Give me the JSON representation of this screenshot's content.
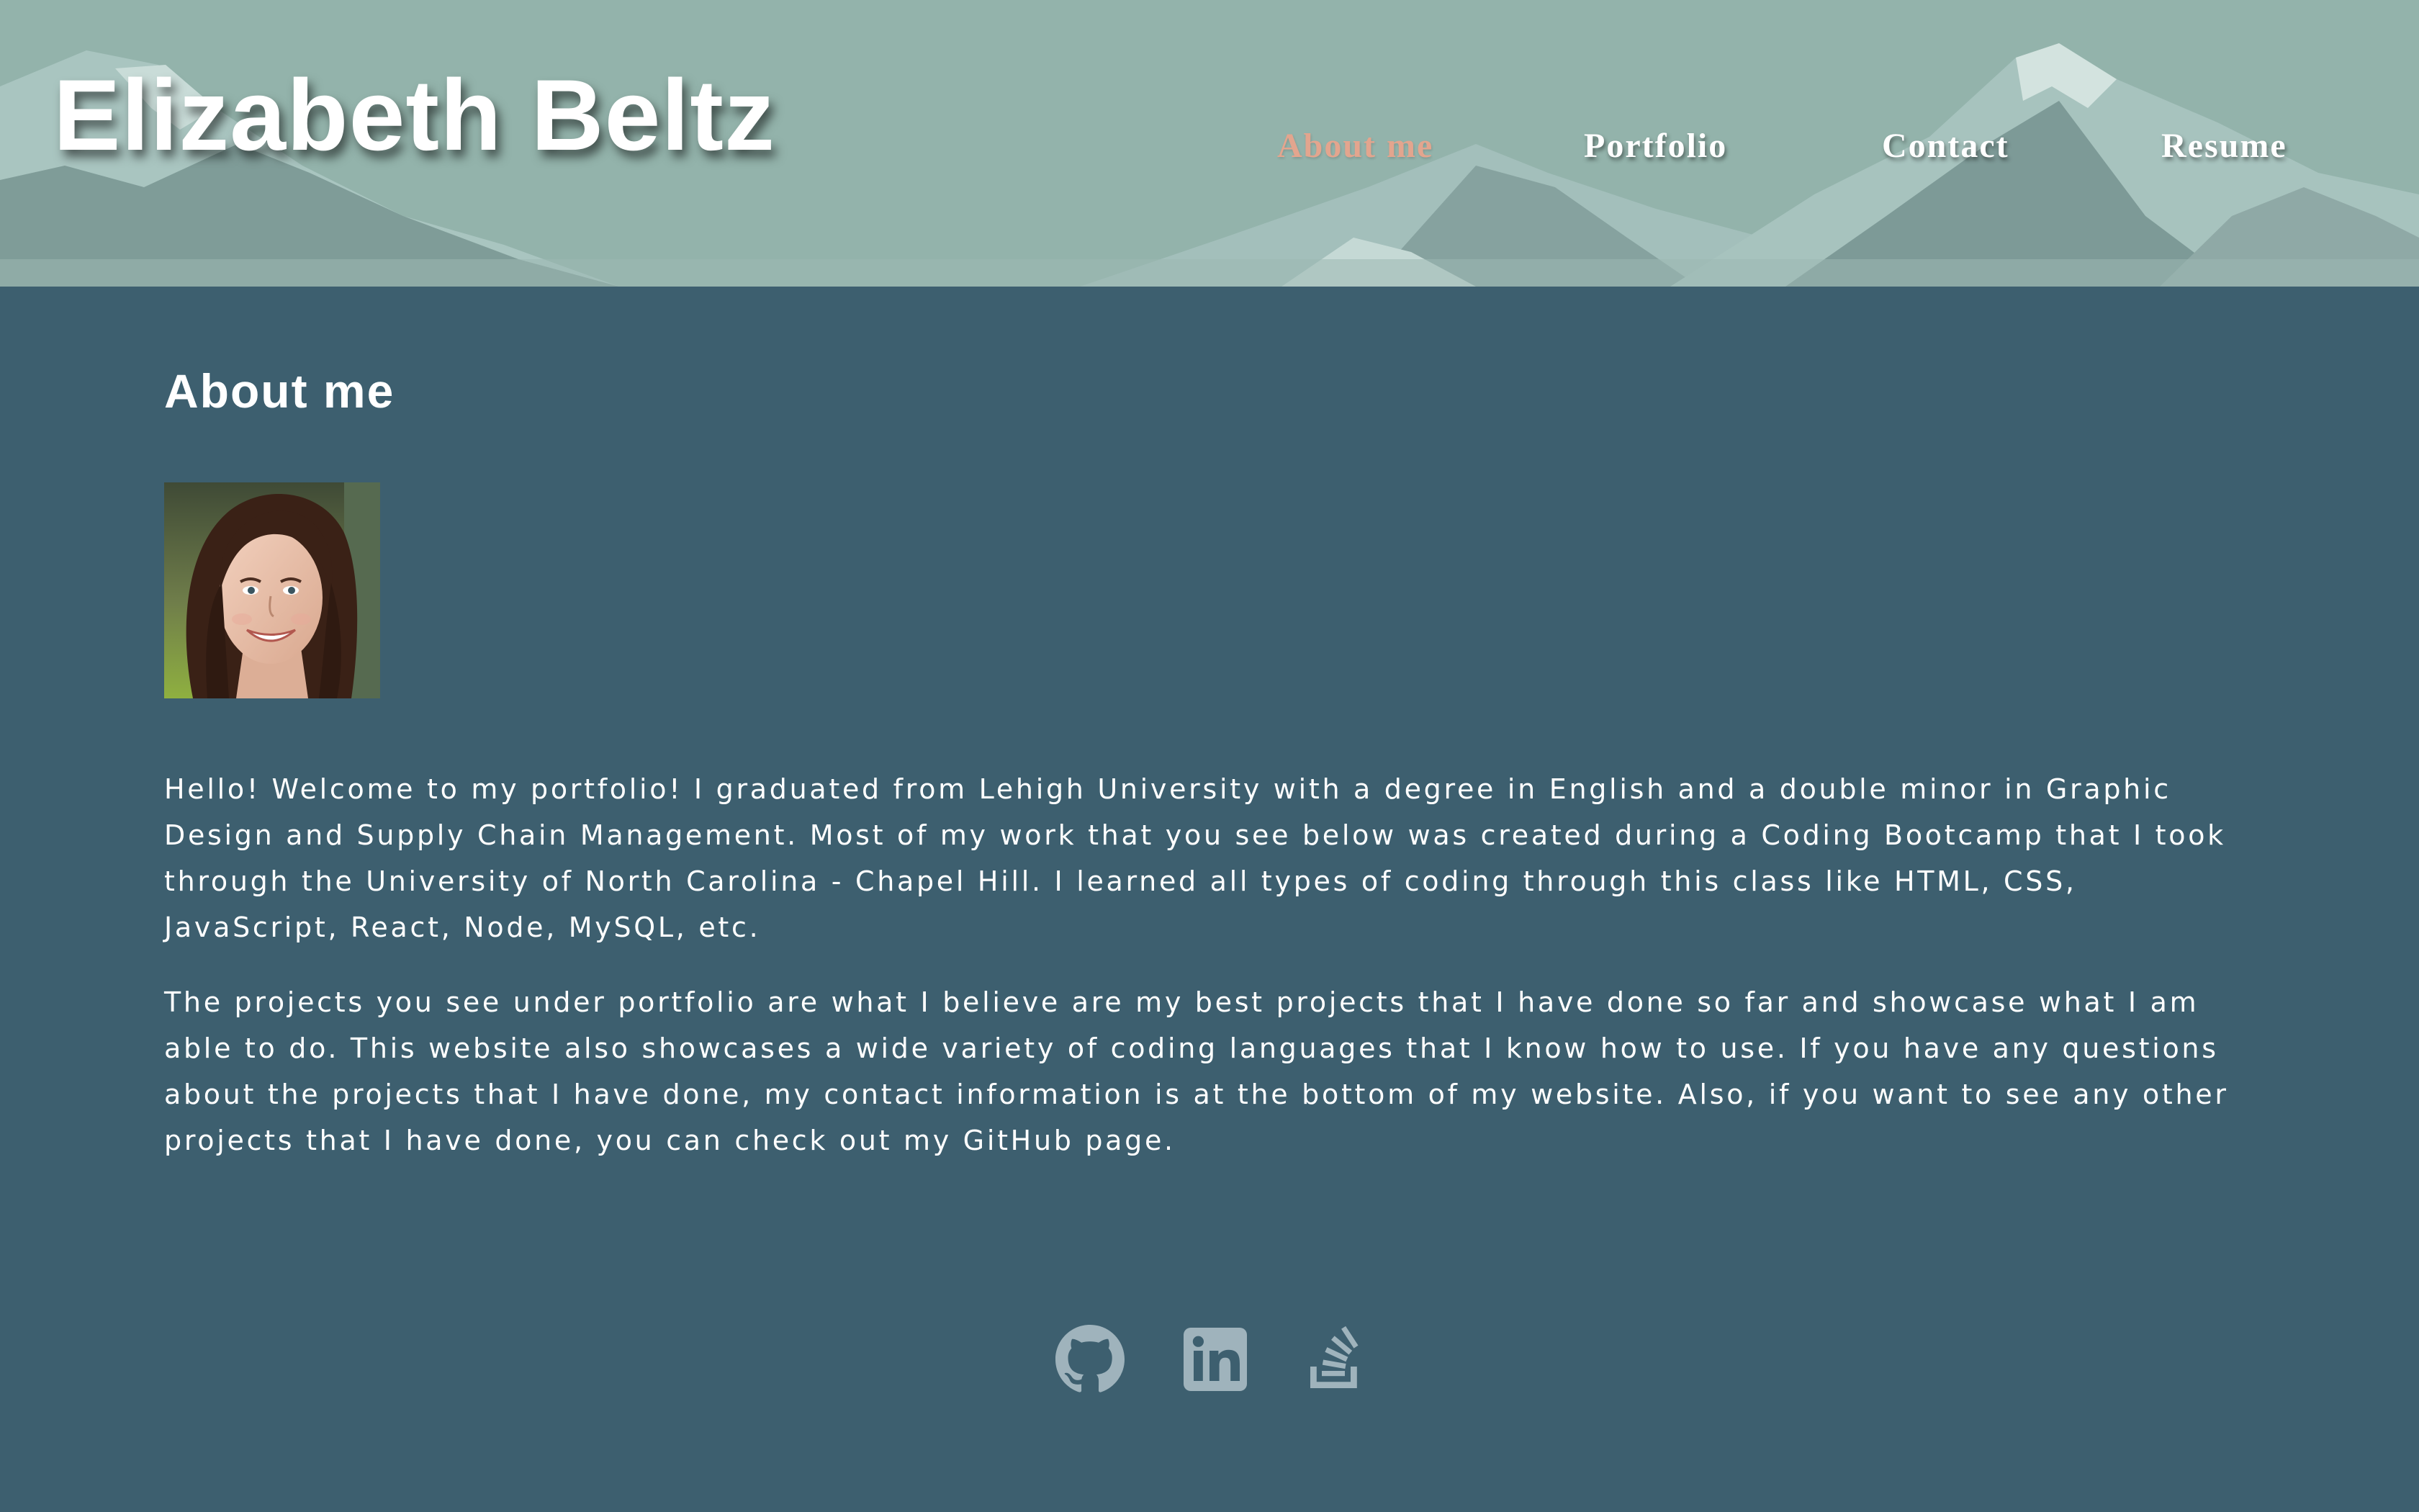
{
  "header": {
    "site_title": "Elizabeth Beltz",
    "nav": [
      {
        "label": "About me",
        "active": true
      },
      {
        "label": "Portfolio",
        "active": false
      },
      {
        "label": "Contact",
        "active": false
      },
      {
        "label": "Resume",
        "active": false
      }
    ]
  },
  "about": {
    "heading": "About me",
    "paragraphs": [
      "Hello! Welcome to my portfolio! I graduated from Lehigh University with a degree in English and a double minor in Graphic Design and Supply Chain Management. Most of my work that you see below was created during a Coding Bootcamp that I took through the University of North Carolina - Chapel Hill. I learned all types of coding through this class like HTML, CSS, JavaScript, React, Node, MySQL, etc.",
      "The projects you see under portfolio are what I believe are my best projects that I have done so far and showcase what I am able to do. This website also showcases a wide variety of coding languages that I know how to use. If you have any questions about the projects that I have done, my contact information is at the bottom of my website. Also, if you want to see any other projects that I have done, you can check out my GitHub page."
    ]
  },
  "footer": {
    "icons": [
      "github-icon",
      "linkedin-icon",
      "stack-overflow-icon"
    ]
  },
  "colors": {
    "header_bg": "#93b3ab",
    "page_bg": "#3d5f6f",
    "nav_active": "#e3a58e",
    "text": "#ffffff",
    "icon": "#9fb3bc"
  }
}
